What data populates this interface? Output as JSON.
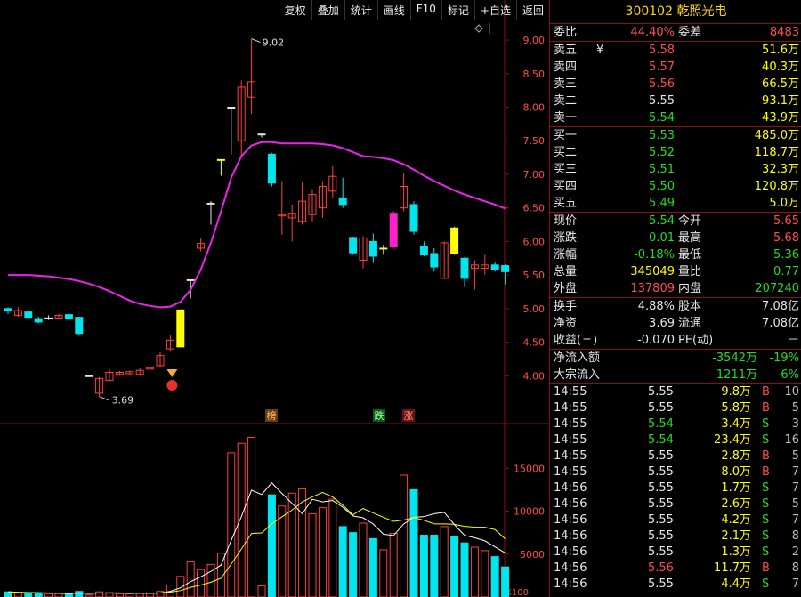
{
  "toolbar": [
    "复权",
    "叠加",
    "统计",
    "画线",
    "F10",
    "标记",
    "+自选",
    "返回"
  ],
  "stock": {
    "code": "300102",
    "name": "乾照光电"
  },
  "weibi": {
    "label": "委比",
    "value": "44.40%",
    "label2": "委差",
    "value2": "8483"
  },
  "asks": [
    {
      "label": "卖五",
      "mark": "¥",
      "price": "5.58",
      "vol": "51.6万",
      "color": "red"
    },
    {
      "label": "卖四",
      "mark": "",
      "price": "5.57",
      "vol": "40.3万",
      "color": "red"
    },
    {
      "label": "卖三",
      "mark": "",
      "price": "5.56",
      "vol": "66.5万",
      "color": "red"
    },
    {
      "label": "卖二",
      "mark": "",
      "price": "5.55",
      "vol": "93.1万",
      "color": "white"
    },
    {
      "label": "卖一",
      "mark": "",
      "price": "5.54",
      "vol": "43.9万",
      "color": "green"
    }
  ],
  "bids": [
    {
      "label": "买一",
      "price": "5.53",
      "vol": "485.0万"
    },
    {
      "label": "买二",
      "price": "5.52",
      "vol": "118.7万"
    },
    {
      "label": "买三",
      "price": "5.51",
      "vol": "32.3万"
    },
    {
      "label": "买四",
      "price": "5.50",
      "vol": "120.8万"
    },
    {
      "label": "买五",
      "price": "5.49",
      "vol": "5.0万"
    }
  ],
  "quote": [
    {
      "l1": "现价",
      "v1": "5.54",
      "c1": "green",
      "l2": "今开",
      "v2": "5.65",
      "c2": "red"
    },
    {
      "l1": "涨跌",
      "v1": "-0.01",
      "c1": "green",
      "l2": "最高",
      "v2": "5.68",
      "c2": "red"
    },
    {
      "l1": "涨幅",
      "v1": "-0.18%",
      "c1": "green",
      "l2": "最低",
      "v2": "5.36",
      "c2": "green"
    },
    {
      "l1": "总量",
      "v1": "345049",
      "c1": "yellow",
      "l2": "量比",
      "v2": "0.77",
      "c2": "green"
    },
    {
      "l1": "外盘",
      "v1": "137809",
      "c1": "red",
      "l2": "内盘",
      "v2": "207240",
      "c2": "green"
    }
  ],
  "fin": [
    {
      "l1": "换手",
      "v1": "4.88%",
      "l2": "股本",
      "v2": "7.08亿"
    },
    {
      "l1": "净资",
      "v1": "3.69",
      "l2": "流通",
      "v2": "7.08亿"
    },
    {
      "l1": "收益(三)",
      "v1": "-0.070",
      "l2": "PE(动)",
      "v2": "－"
    }
  ],
  "flow": [
    {
      "label": "净流入额",
      "value": "-3542万",
      "pct": "-19%"
    },
    {
      "label": "大宗流入",
      "value": "-1211万",
      "pct": "-6%"
    }
  ],
  "ticks": [
    {
      "time": "14:55",
      "price": "5.55",
      "vol": "9.8万",
      "bs": "B",
      "n": "10"
    },
    {
      "time": "14:55",
      "price": "5.55",
      "vol": "5.8万",
      "bs": "B",
      "n": "5"
    },
    {
      "time": "14:55",
      "price": "5.54",
      "vol": "3.4万",
      "bs": "S",
      "n": "3"
    },
    {
      "time": "14:55",
      "price": "5.54",
      "vol": "23.4万",
      "bs": "S",
      "n": "16"
    },
    {
      "time": "14:55",
      "price": "5.55",
      "vol": "2.8万",
      "bs": "B",
      "n": "5"
    },
    {
      "time": "14:55",
      "price": "5.55",
      "vol": "8.0万",
      "bs": "B",
      "n": "7"
    },
    {
      "time": "14:56",
      "price": "5.55",
      "vol": "1.7万",
      "bs": "S",
      "n": "7"
    },
    {
      "time": "14:56",
      "price": "5.55",
      "vol": "2.6万",
      "bs": "S",
      "n": "5"
    },
    {
      "time": "14:56",
      "price": "5.55",
      "vol": "4.2万",
      "bs": "S",
      "n": "7"
    },
    {
      "time": "14:56",
      "price": "5.55",
      "vol": "2.1万",
      "bs": "S",
      "n": "8"
    },
    {
      "time": "14:56",
      "price": "5.55",
      "vol": "1.3万",
      "bs": "S",
      "n": "2"
    },
    {
      "time": "14:56",
      "price": "5.56",
      "vol": "11.7万",
      "bs": "B",
      "n": "8"
    },
    {
      "time": "14:56",
      "price": "5.55",
      "vol": "4.4万",
      "bs": "S",
      "n": "7"
    }
  ],
  "chart_data": {
    "type": "candlestick",
    "price_ticks": [
      "9.00",
      "8.50",
      "8.00",
      "7.50",
      "7.00",
      "6.50",
      "6.00",
      "5.50",
      "5.00",
      "4.50",
      "4.00"
    ],
    "vol_ticks": [
      "15000",
      "10000",
      "5000"
    ],
    "vol_unit": "X100",
    "annotations": {
      "high": "9.02",
      "low": "3.69"
    },
    "badges": [
      "榜",
      "跌",
      "涨"
    ],
    "candles": [
      {
        "o": 5.0,
        "c": 4.97,
        "h": 5.02,
        "l": 4.92,
        "v": 600
      },
      {
        "o": 4.9,
        "c": 4.97,
        "h": 5.02,
        "l": 4.88,
        "v": 500
      },
      {
        "o": 4.95,
        "c": 4.87,
        "h": 4.96,
        "l": 4.84,
        "v": 450
      },
      {
        "o": 4.85,
        "c": 4.8,
        "h": 4.88,
        "l": 4.78,
        "v": 400
      },
      {
        "o": 4.86,
        "c": 4.86,
        "h": 4.9,
        "l": 4.83,
        "v": 380
      },
      {
        "o": 4.86,
        "c": 4.9,
        "h": 4.92,
        "l": 4.84,
        "v": 420
      },
      {
        "o": 4.91,
        "c": 4.85,
        "h": 4.92,
        "l": 4.82,
        "v": 390
      },
      {
        "o": 4.87,
        "c": 4.63,
        "h": 4.88,
        "l": 4.6,
        "v": 650
      },
      {
        "o": 4.0,
        "c": 4.0,
        "h": 4.01,
        "l": 3.99,
        "v": 250
      },
      {
        "o": 3.74,
        "c": 3.96,
        "h": 3.98,
        "l": 3.69,
        "v": 600
      },
      {
        "o": 3.93,
        "c": 4.05,
        "h": 4.1,
        "l": 3.92,
        "v": 500
      },
      {
        "o": 4.02,
        "c": 4.05,
        "h": 4.07,
        "l": 4.0,
        "v": 400
      },
      {
        "o": 4.03,
        "c": 4.06,
        "h": 4.08,
        "l": 4.01,
        "v": 380
      },
      {
        "o": 4.02,
        "c": 4.08,
        "h": 4.11,
        "l": 4.0,
        "v": 420
      },
      {
        "o": 4.1,
        "c": 4.12,
        "h": 4.14,
        "l": 4.08,
        "v": 450
      },
      {
        "o": 4.15,
        "c": 4.3,
        "h": 4.35,
        "l": 4.12,
        "v": 650
      },
      {
        "o": 4.4,
        "c": 4.53,
        "h": 4.6,
        "l": 4.36,
        "v": 1400
      },
      {
        "o": 4.43,
        "c": 4.98,
        "h": 4.98,
        "l": 4.43,
        "v": 2400
      },
      {
        "o": 5.43,
        "c": 5.43,
        "h": 5.43,
        "l": 5.15,
        "v": 4100
      },
      {
        "o": 5.9,
        "c": 5.97,
        "h": 6.05,
        "l": 5.85,
        "v": 3200
      },
      {
        "o": 6.57,
        "c": 6.57,
        "h": 6.6,
        "l": 6.25,
        "v": 3800
      },
      {
        "o": 7.22,
        "c": 7.22,
        "h": 7.22,
        "l": 6.98,
        "v": 5100
      },
      {
        "o": 8.0,
        "c": 8.0,
        "h": 8.0,
        "l": 7.3,
        "v": 16800
      },
      {
        "o": 7.5,
        "c": 8.3,
        "h": 8.4,
        "l": 7.25,
        "v": 17900
      },
      {
        "o": 8.15,
        "c": 8.38,
        "h": 9.02,
        "l": 7.9,
        "v": 18600
      },
      {
        "o": 7.6,
        "c": 7.6,
        "h": 7.6,
        "l": 7.55,
        "v": 1300
      },
      {
        "o": 7.3,
        "c": 6.87,
        "h": 7.32,
        "l": 6.82,
        "v": 11900
      },
      {
        "o": 6.38,
        "c": 6.4,
        "h": 6.9,
        "l": 6.1,
        "v": 10600
      },
      {
        "o": 6.35,
        "c": 6.42,
        "h": 6.55,
        "l": 6.0,
        "v": 12100
      },
      {
        "o": 6.3,
        "c": 6.6,
        "h": 6.88,
        "l": 6.25,
        "v": 12600
      },
      {
        "o": 6.4,
        "c": 6.7,
        "h": 6.78,
        "l": 6.3,
        "v": 9700
      },
      {
        "o": 6.5,
        "c": 6.82,
        "h": 6.9,
        "l": 6.35,
        "v": 10400
      },
      {
        "o": 6.75,
        "c": 6.97,
        "h": 7.12,
        "l": 6.65,
        "v": 11400
      },
      {
        "o": 6.65,
        "c": 6.55,
        "h": 6.95,
        "l": 6.5,
        "v": 8200
      },
      {
        "o": 6.06,
        "c": 5.83,
        "h": 6.07,
        "l": 5.8,
        "v": 7500
      },
      {
        "o": 5.72,
        "c": 6.05,
        "h": 6.08,
        "l": 5.6,
        "v": 8600
      },
      {
        "o": 6.0,
        "c": 5.78,
        "h": 6.12,
        "l": 5.68,
        "v": 6800
      },
      {
        "o": 5.9,
        "c": 5.9,
        "h": 5.95,
        "l": 5.8,
        "v": 5500
      },
      {
        "o": 5.92,
        "c": 6.42,
        "h": 6.45,
        "l": 5.9,
        "v": 7400
      },
      {
        "o": 6.5,
        "c": 6.82,
        "h": 7.02,
        "l": 6.45,
        "v": 14200
      },
      {
        "o": 6.55,
        "c": 6.15,
        "h": 6.6,
        "l": 6.1,
        "v": 12500
      },
      {
        "o": 5.92,
        "c": 5.8,
        "h": 6.0,
        "l": 5.78,
        "v": 7200
      },
      {
        "o": 5.82,
        "c": 5.62,
        "h": 5.9,
        "l": 5.55,
        "v": 7200
      },
      {
        "o": 5.45,
        "c": 5.98,
        "h": 6.0,
        "l": 5.45,
        "v": 8200
      },
      {
        "o": 6.2,
        "c": 5.82,
        "h": 6.22,
        "l": 5.8,
        "v": 7000
      },
      {
        "o": 5.75,
        "c": 5.45,
        "h": 5.77,
        "l": 5.32,
        "v": 6300
      },
      {
        "o": 5.6,
        "c": 5.65,
        "h": 5.72,
        "l": 5.28,
        "v": 5800
      },
      {
        "o": 5.6,
        "c": 5.65,
        "h": 5.8,
        "l": 5.5,
        "v": 5400
      },
      {
        "o": 5.65,
        "c": 5.58,
        "h": 5.7,
        "l": 5.55,
        "v": 4700
      },
      {
        "o": 5.64,
        "c": 5.55,
        "h": 5.66,
        "l": 5.36,
        "v": 3500
      }
    ],
    "ma": [
      5.5,
      5.5,
      5.5,
      5.49,
      5.48,
      5.46,
      5.44,
      5.41,
      5.37,
      5.32,
      5.26,
      5.19,
      5.12,
      5.07,
      5.04,
      5.02,
      5.03,
      5.1,
      5.28,
      5.58,
      5.98,
      6.45,
      6.95,
      7.27,
      7.43,
      7.48,
      7.48,
      7.46,
      7.46,
      7.46,
      7.46,
      7.45,
      7.43,
      7.39,
      7.33,
      7.27,
      7.26,
      7.24,
      7.21,
      7.15,
      7.07,
      6.98,
      6.9,
      6.83,
      6.76,
      6.7,
      6.65,
      6.6,
      6.55,
      6.49
    ]
  }
}
